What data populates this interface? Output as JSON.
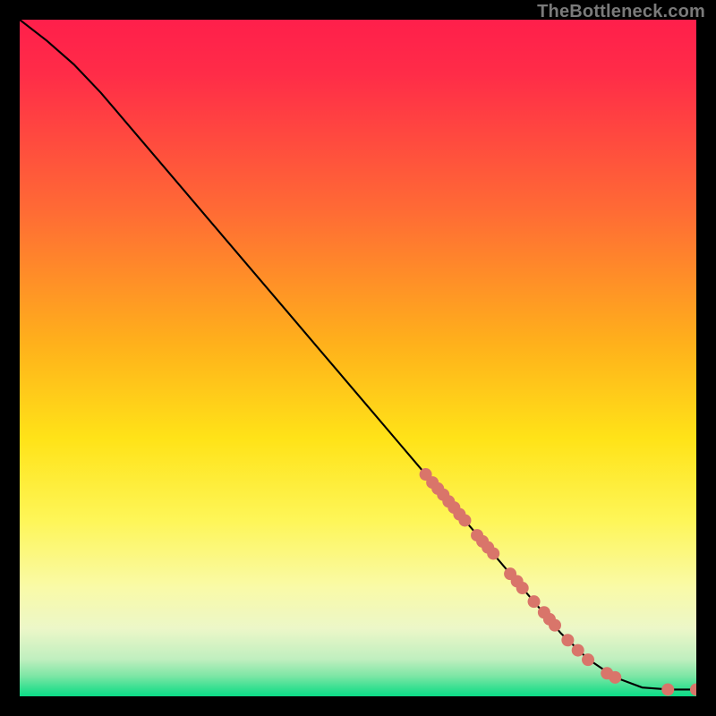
{
  "attribution": "TheBottleneck.com",
  "colors": {
    "frame": "#000000",
    "curve_stroke": "#000000",
    "marker_fill": "#d9756a",
    "gradient_stops": [
      {
        "offset": 0.0,
        "color": "#ff1f4b"
      },
      {
        "offset": 0.08,
        "color": "#ff2c48"
      },
      {
        "offset": 0.28,
        "color": "#ff6a35"
      },
      {
        "offset": 0.48,
        "color": "#ffb11b"
      },
      {
        "offset": 0.62,
        "color": "#ffe318"
      },
      {
        "offset": 0.74,
        "color": "#fef658"
      },
      {
        "offset": 0.84,
        "color": "#f9faa8"
      },
      {
        "offset": 0.9,
        "color": "#ecf7c8"
      },
      {
        "offset": 0.945,
        "color": "#c0efbf"
      },
      {
        "offset": 0.97,
        "color": "#7de6a5"
      },
      {
        "offset": 0.99,
        "color": "#2fdf8f"
      },
      {
        "offset": 1.0,
        "color": "#0bdc87"
      }
    ]
  },
  "chart_data": {
    "type": "line",
    "title": "",
    "xlabel": "",
    "ylabel": "",
    "x_range": [
      0,
      100
    ],
    "y_range": [
      0,
      100
    ],
    "curve_xy": [
      [
        0,
        100
      ],
      [
        4,
        96.9
      ],
      [
        8,
        93.4
      ],
      [
        12,
        89.2
      ],
      [
        16,
        84.5
      ],
      [
        20,
        79.8
      ],
      [
        24,
        75.1
      ],
      [
        28,
        70.4
      ],
      [
        32,
        65.7
      ],
      [
        36,
        61.0
      ],
      [
        40,
        56.3
      ],
      [
        44,
        51.6
      ],
      [
        48,
        46.9
      ],
      [
        52,
        42.2
      ],
      [
        56,
        37.5
      ],
      [
        60,
        32.8
      ],
      [
        64,
        28.1
      ],
      [
        68,
        23.4
      ],
      [
        72,
        18.7
      ],
      [
        76,
        14.0
      ],
      [
        80,
        9.3
      ],
      [
        84,
        5.5
      ],
      [
        88,
        2.8
      ],
      [
        92,
        1.3
      ],
      [
        96,
        1.0
      ],
      [
        100,
        1.0
      ]
    ],
    "markers_xy": [
      [
        60.0,
        32.8
      ],
      [
        61.0,
        31.6
      ],
      [
        61.8,
        30.7
      ],
      [
        62.6,
        29.8
      ],
      [
        63.4,
        28.8
      ],
      [
        64.2,
        27.9
      ],
      [
        65.0,
        26.9
      ],
      [
        65.8,
        26.0
      ],
      [
        67.6,
        23.8
      ],
      [
        68.4,
        22.9
      ],
      [
        69.2,
        22.0
      ],
      [
        70.0,
        21.1
      ],
      [
        72.5,
        18.1
      ],
      [
        73.5,
        17.0
      ],
      [
        74.3,
        16.0
      ],
      [
        76.0,
        14.0
      ],
      [
        77.5,
        12.4
      ],
      [
        78.3,
        11.4
      ],
      [
        79.1,
        10.5
      ],
      [
        81.0,
        8.3
      ],
      [
        82.5,
        6.8
      ],
      [
        84.0,
        5.4
      ],
      [
        86.8,
        3.4
      ],
      [
        88.0,
        2.8
      ],
      [
        95.8,
        1.0
      ],
      [
        100.0,
        1.0
      ]
    ],
    "marker_radius_px": 7
  }
}
